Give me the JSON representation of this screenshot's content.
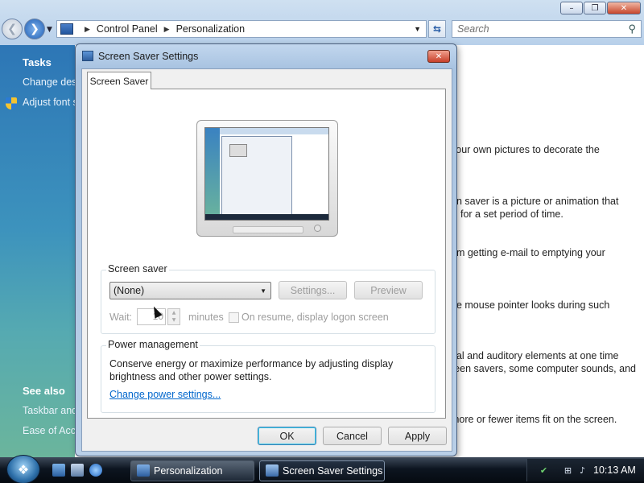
{
  "explorer": {
    "caption_buttons": {
      "minimize": "–",
      "maximize": "❐",
      "close": "✕"
    },
    "breadcrumb": [
      "Control Panel",
      "Personalization"
    ],
    "search_placeholder": "Search",
    "left_pane": {
      "tasks_heading": "Tasks",
      "tasks": [
        "Change desk",
        "Adjust font s"
      ],
      "see_also_heading": "See also",
      "see_also": [
        "Taskbar and",
        "Ease of Acce"
      ]
    },
    "content_lines": [
      "your own pictures to decorate the",
      "en saver is a picture or animation that",
      "for a set period of time.",
      "om getting e-mail to emptying your",
      "he mouse pointer looks during such",
      "ual and auditory elements at one time",
      "reen savers, some computer sounds, and",
      "more or fewer items fit on the screen."
    ]
  },
  "dialog": {
    "title": "Screen Saver Settings",
    "close_glyph": "✕",
    "tab_label": "Screen Saver",
    "screen_saver": {
      "group_label": "Screen saver",
      "selected": "(None)",
      "settings_button": "Settings...",
      "preview_button": "Preview",
      "wait_label": "Wait:",
      "wait_value": "10",
      "minutes_label": "minutes",
      "resume_label": "On resume, display logon screen",
      "resume_checked": false
    },
    "power": {
      "group_label": "Power management",
      "description": "Conserve energy or maximize performance by adjusting display brightness and other power settings.",
      "link": "Change power settings..."
    },
    "buttons": {
      "ok": "OK",
      "cancel": "Cancel",
      "apply": "Apply"
    }
  },
  "taskbar": {
    "start_glyph": "❖",
    "items": [
      {
        "label": "Personalization",
        "active": false
      },
      {
        "label": "Screen Saver Settings",
        "active": true
      }
    ],
    "clock": "10:13 AM"
  },
  "icons": {
    "shield": "uac-shield-icon",
    "search": "search-icon",
    "refresh": "refresh-icon",
    "back": "back-arrow-icon",
    "forward": "forward-arrow-icon"
  },
  "colors": {
    "link": "#0066cc",
    "left_pane_top": "#2d76b6",
    "left_pane_bottom": "#6bb59c",
    "taskbar": "#0d1520"
  }
}
